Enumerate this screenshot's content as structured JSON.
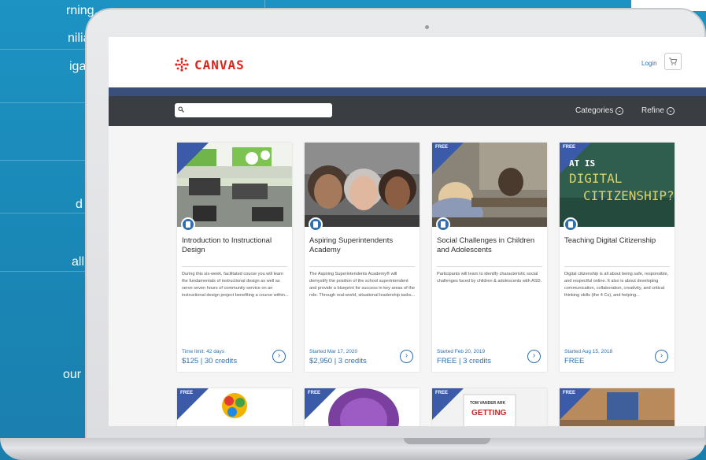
{
  "background_text": {
    "lines": [
      "rning.",
      "niliar",
      "igate",
      "d",
      "all",
      "our"
    ]
  },
  "app": {
    "logo_text": "CANVAS",
    "login_label": "Login",
    "cart_icon": "cart-icon",
    "search_placeholder": "",
    "nav": {
      "categories_label": "Categories",
      "refine_label": "Refine"
    }
  },
  "colors": {
    "brand_red": "#e2231a",
    "accent_blue": "#2f6fb0",
    "nav_dark": "#3a3d42",
    "band": "#3a4f7a",
    "background": "#1c93c3"
  },
  "courses": [
    {
      "badge": "",
      "title": "Introduction to Instructional Design",
      "description": "During this six-week, facilitated course you will learn the fundamentals of instructional design as well as serve seven hours of community service on an instructional design project benefiting a course within...",
      "meta": "Time limit: 42 days",
      "price": "$125 | 30 credits"
    },
    {
      "badge": "",
      "title": "Aspiring Superintendents Academy",
      "description": "The Aspiring Superintendents Academy® will demystify the position of the school superintendent and provide a blueprint for success in key areas of the role. Through real-world, situational leadership tasks...",
      "meta": "Started Mar 17, 2020",
      "price": "$2,950 | 3 credits"
    },
    {
      "badge": "FREE",
      "title": "Social Challenges in Children and Adolescents",
      "description": "Participants will learn to identify characteristic social challenges faced by children & adolescents with ASD.",
      "meta": "Started Feb 20, 2019",
      "price": "FREE | 3 credits"
    },
    {
      "badge": "FREE",
      "title": "Teaching Digital Citizenship",
      "description": "Digital citizenship is all about being safe, responsible, and respectful online. It also is about developing communication, collaboration, creativity, and critical thinking skills (the 4 Cs), and helping...",
      "meta": "Started Aug 15, 2018",
      "price": "FREE",
      "image_text": [
        "AT IS",
        "DIGITAL",
        "CITIZENSHIP?"
      ]
    }
  ],
  "second_row": [
    {
      "badge": "FREE"
    },
    {
      "badge": "FREE"
    },
    {
      "badge": "FREE",
      "image_text": [
        "TOM VANDER ARK",
        "GETTING"
      ]
    },
    {
      "badge": "FREE"
    }
  ]
}
